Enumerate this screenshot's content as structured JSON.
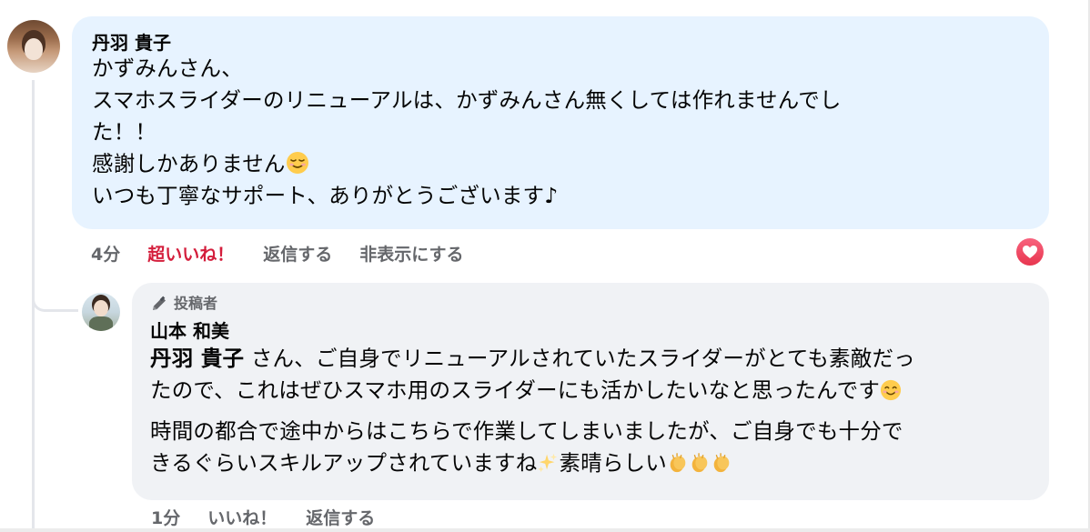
{
  "comment": {
    "author": "丹羽 貴子",
    "lines": [
      "かずみんさん、",
      "スマホスライダーのリニューアルは、かずみんさん無くしては作れませんでし",
      "た！！",
      "感謝しかありません",
      "いつも丁寧なサポート、ありがとうございます♪"
    ],
    "actions": {
      "time": "4分",
      "super_like": "超いいね！",
      "reply": "返信する",
      "hide": "非表示にする"
    },
    "reaction_icon": "heart-reaction-icon",
    "accent_color": "#d41e3c"
  },
  "reply": {
    "role_badge": "投稿者",
    "author": "山本 和美",
    "mention": "丹羽 貴子",
    "para1_line1_rest": " さん、ご自身でリニューアルされていたスライダーがとても素敵だっ",
    "para1_line2": "たので、これはぜひスマホ用のスライダーにも活かしたいなと思ったんです",
    "para2_line1": "時間の都合で途中からはこちらで作業してしまいましたが、ご自身でも十分で",
    "para2_line2_a": "きるぐらいスキルアップされていますね",
    "para2_line2_b": "素晴らしい",
    "actions": {
      "time": "1分",
      "like": "いいね！",
      "reply": "返信する"
    }
  },
  "colors": {
    "comment_bubble": "#e7f3ff",
    "reply_bubble": "#f0f2f5",
    "muted_text": "#65676b"
  }
}
